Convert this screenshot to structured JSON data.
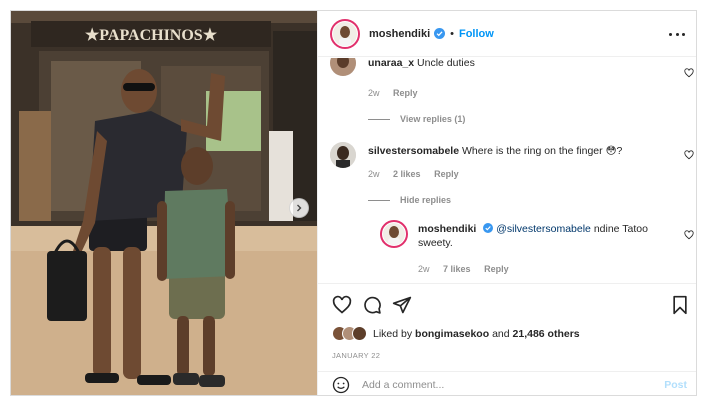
{
  "post": {
    "photo": {
      "storefront_sign": "★PAPACHINOS★",
      "alt_description": ""
    },
    "header": {
      "username": "moshendiki",
      "separator": "•",
      "follow_label": "Follow",
      "verified": true
    },
    "comments": [
      {
        "username": "unaraa_x",
        "text": "Uncle duties",
        "age": "2w",
        "likes": "",
        "reply_label": "Reply",
        "view_replies": "View replies (1)"
      },
      {
        "username": "silvestersomabele",
        "text": "Where is the ring on the finger",
        "emoji": "😳?",
        "age": "2w",
        "likes": "2 likes",
        "reply_label": "Reply",
        "hide_replies": "Hide replies"
      }
    ],
    "reply": {
      "username": "moshendiki",
      "mention": "@silvestersomabele",
      "text": "ndine Tatoo sweety.",
      "age": "2w",
      "likes": "7 likes",
      "reply_label": "Reply"
    },
    "likes": {
      "prefix": "Liked by",
      "user": "bongimasekoo",
      "and": "and",
      "others": "21,486 others"
    },
    "date": "JANUARY 22",
    "add_comment": {
      "placeholder": "Add a comment...",
      "post_label": "Post"
    },
    "icons": {
      "like": "heart-icon",
      "comment": "comment-icon",
      "share": "send-icon",
      "save": "bookmark-icon",
      "emoji": "emoji-icon",
      "more": "more-options-icon",
      "next": "chevron-right-icon"
    },
    "colors": {
      "link_blue": "#0095f6",
      "mention_blue": "#00376b",
      "muted": "#8e8e8e",
      "story_ring": "#e1306c"
    }
  }
}
